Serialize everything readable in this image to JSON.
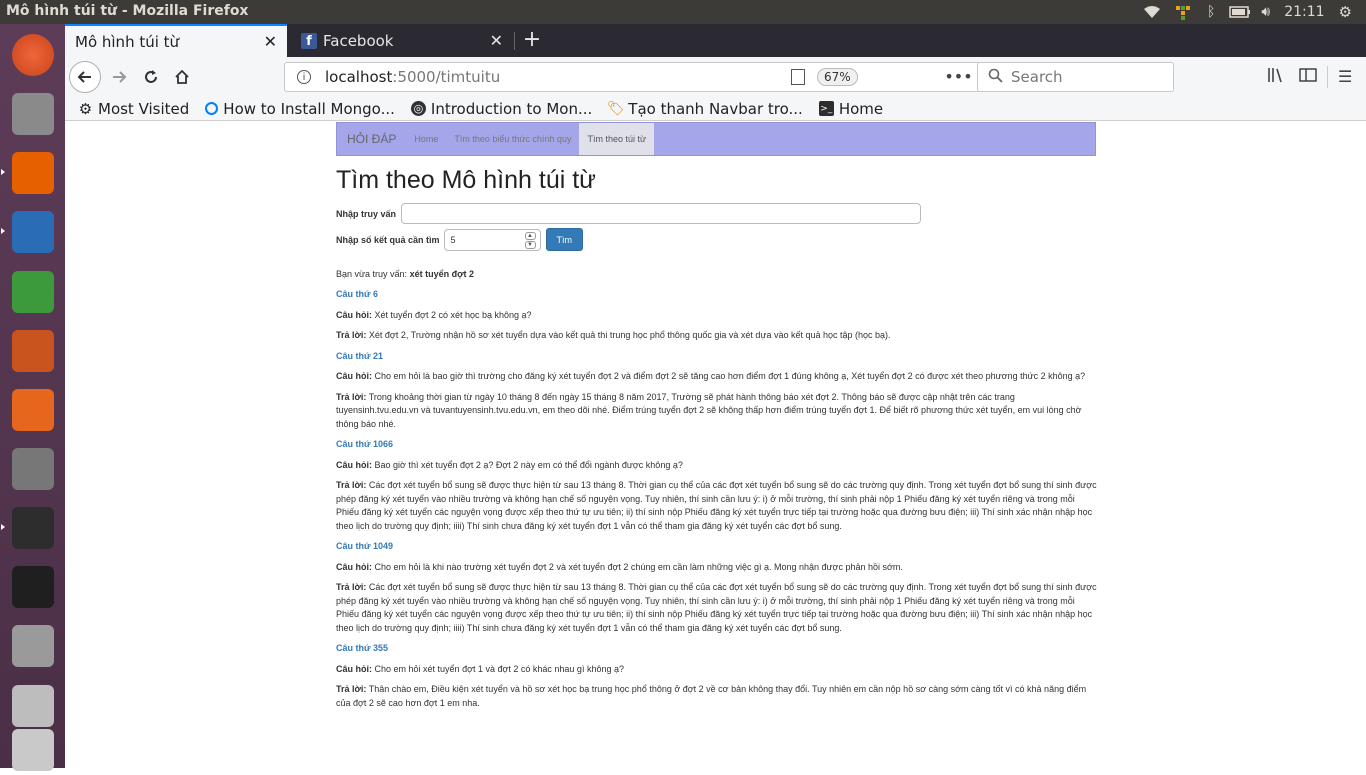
{
  "window": {
    "title": "Mô hình túi từ - Mozilla Firefox",
    "clock": "21:11"
  },
  "tabs": [
    {
      "label": "Mô hình túi từ"
    },
    {
      "label": "Facebook"
    }
  ],
  "navbar": {
    "url_host": "localhost",
    "url_path": ":5000/timtuitu",
    "zoom": "67%",
    "search_placeholder": "Search"
  },
  "bookmarks": [
    {
      "label": "Most Visited",
      "icon": "gear-icon"
    },
    {
      "label": "How to Install Mongo...",
      "icon": "digitalocean-icon"
    },
    {
      "label": "Introduction to Mon...",
      "icon": "globe-icon"
    },
    {
      "label": "Tạo thanh Navbar tro...",
      "icon": "bookmark-icon"
    },
    {
      "label": "Home",
      "icon": "terminal-icon"
    }
  ],
  "site_nav": {
    "brand": "HỎI ĐÁP",
    "links": [
      "Home",
      "Tìm theo biểu thức chính quy",
      "Tìm theo túi từ"
    ]
  },
  "main": {
    "heading": "Tìm theo Mô hình túi từ",
    "query_label": "Nhập truy vấn",
    "query_value": "",
    "count_label": "Nhập số kết quả cần tìm",
    "count_value": "5",
    "search_button": "Tìm",
    "query_prefix": "Bạn vừa truy vấn:",
    "query_text": "xét tuyển đợt 2"
  },
  "question_label": "Câu hỏi:",
  "answer_label": "Trả lời:",
  "results": [
    {
      "title": "Câu thứ 6",
      "question": "Xét tuyển đợt 2 có xét học bạ không ạ?",
      "answer": "Xét đợt 2, Trường nhận hồ sơ xét tuyển dựa vào kết quả thi trung học phổ thông quốc gia và xét dựa vào kết quả học tập (học bạ)."
    },
    {
      "title": "Câu thứ 21",
      "question": "Cho em hỏi là bao giờ thì trường cho đăng ký xét tuyển đợt 2 và điểm đợt 2 sẽ tăng cao hơn điểm đợt 1 đúng không ạ, Xét tuyển đợt 2 có được xét theo phương thức 2 không ạ?",
      "answer": "Trong khoảng thời gian từ ngày 10 tháng 8 đến ngày 15 tháng 8 năm 2017, Trường sẽ phát hành thông báo xét đợt 2. Thông báo sẽ được cập nhật trên các trang tuyensinh.tvu.edu.vn và tuvantuyensinh.tvu.edu.vn, em theo dõi nhé. Điểm trúng tuyển đợt 2 sẽ không thấp hơn điểm trúng tuyển đợt 1. Để biết rõ phương thức xét tuyển, em vui lòng chờ thông báo nhé."
    },
    {
      "title": "Câu thứ 1066",
      "question": "Bao giờ thì xét tuyển đợt 2 ạ? Đợt 2 này em có thể đổi ngành được không ạ?",
      "answer": "Các đợt xét tuyển bổ sung sẽ được thực hiện từ sau 13 tháng 8. Thời gian cụ thể của các đợt xét tuyển bổ sung sẽ do các trường quy định. Trong xét tuyển đợt bổ sung thí sinh được phép đăng ký xét tuyển vào nhiều trường và không hạn chế số nguyện vọng. Tuy nhiên, thí sinh cần lưu ý: i) ở mỗi trường, thí sinh phải nộp 1 Phiếu đăng ký xét tuyển riêng và trong mỗi Phiếu đăng ký xét tuyển các nguyện vọng được xếp theo thứ tự ưu tiên; ii) thí sinh nộp Phiếu đăng ký xét tuyển trực tiếp tại trường hoặc qua đường bưu điện; iii) Thí sinh xác nhận nhập học theo lịch do trường quy định; iiii) Thí sinh chưa đăng ký xét tuyển đợt 1 vẫn có thể tham gia đăng ký xét tuyển các đợt bổ sung."
    },
    {
      "title": "Câu thứ 1049",
      "question": "Cho em hỏi là khi nào trường xét tuyển đợt 2 và xét tuyển đợt 2 chúng em cần làm những việc gì ạ. Mong nhận được phản hồi sớm.",
      "answer": "Các đợt xét tuyển bổ sung sẽ được thực hiện từ sau 13 tháng 8. Thời gian cụ thể của các đợt xét tuyển bổ sung sẽ do các trường quy định. Trong xét tuyển đợt bổ sung thí sinh được phép đăng ký xét tuyển vào nhiều trường và không hạn chế số nguyện vọng. Tuy nhiên, thí sinh cần lưu ý: i) ở mỗi trường, thí sinh phải nộp 1 Phiếu đăng ký xét tuyển riêng và trong mỗi Phiếu đăng ký xét tuyển các nguyện vọng được xếp theo thứ tự ưu tiên; ii) thí sinh nộp Phiếu đăng ký xét tuyển trực tiếp tại trường hoặc qua đường bưu điện; iii) Thí sinh xác nhận nhập học theo lịch do trường quy định; iiii) Thí sinh chưa đăng ký xét tuyển đợt 1 vẫn có thể tham gia đăng ký xét tuyển các đợt bổ sung."
    },
    {
      "title": "Câu thứ 355",
      "question": "Cho em hỏi xét tuyển đợt 1 và đợt 2 có khác nhau gì không ạ?",
      "answer": "Thân chào em, Điều kiện xét tuyển và hồ sơ xét học bạ trung học phổ thông ở đợt 2 về cơ bản không thay đổi. Tuy nhiên em cần nộp hồ sơ càng sớm càng tốt vì có khả năng điểm của đợt 2 sẽ cao hơn đợt 1 em nha."
    }
  ],
  "launcher_apps": [
    {
      "name": "ubuntu-dash-icon",
      "color": "#e95420"
    },
    {
      "name": "files-icon",
      "color": "#8a8a8a"
    },
    {
      "name": "firefox-icon",
      "color": "#e66000"
    },
    {
      "name": "writer-icon",
      "color": "#2a6cb5"
    },
    {
      "name": "calc-icon",
      "color": "#3c9a3c"
    },
    {
      "name": "impress-icon",
      "color": "#c9541e"
    },
    {
      "name": "software-center-icon",
      "color": "#e5661c"
    },
    {
      "name": "settings-icon",
      "color": "#777777"
    },
    {
      "name": "terminal-icon",
      "color": "#2d2d2d"
    },
    {
      "name": "pycharm-icon",
      "color": "#1f1f1f"
    },
    {
      "name": "camera-icon",
      "color": "#9a9a9a"
    },
    {
      "name": "drive-icon",
      "color": "#bdbdbd"
    },
    {
      "name": "trash-icon",
      "color": "#c9c9c9"
    }
  ]
}
